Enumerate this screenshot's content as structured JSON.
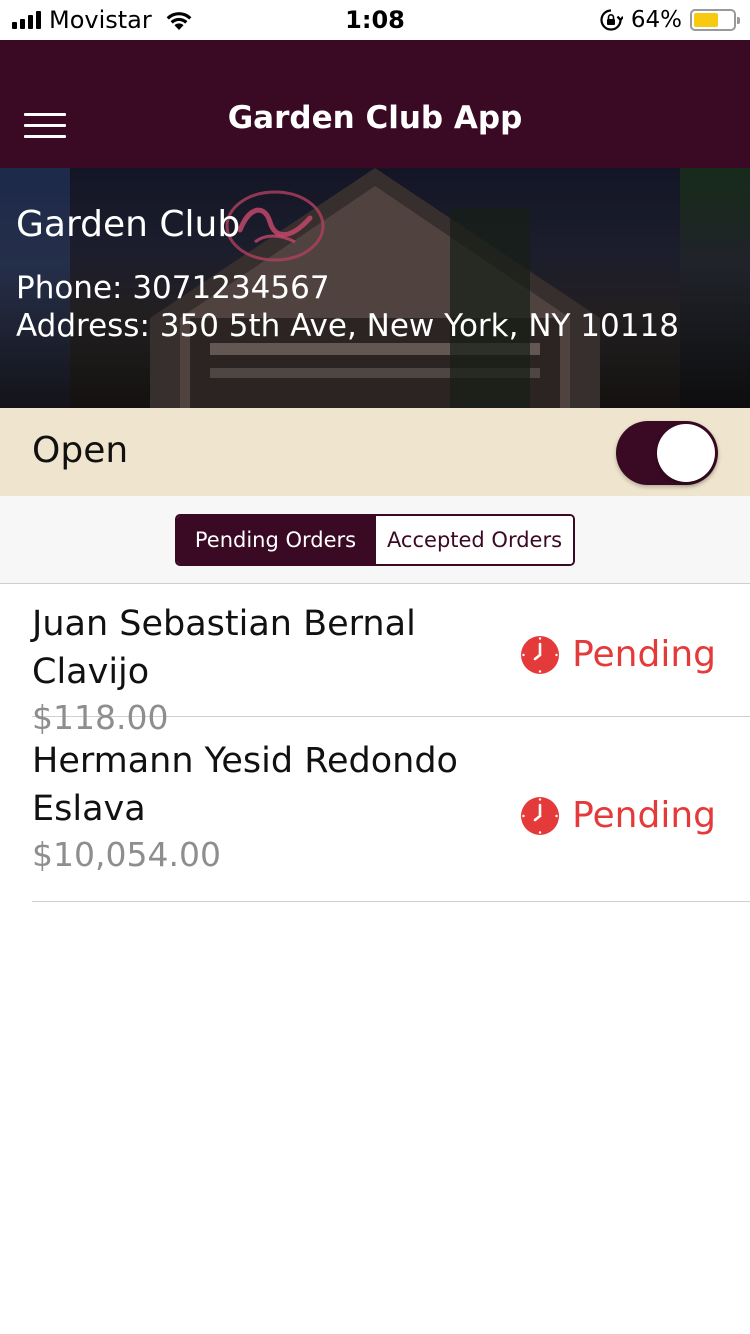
{
  "status_bar": {
    "carrier": "Movistar",
    "time": "1:08",
    "battery_percent": "64%",
    "battery_level": 0.64,
    "icons": [
      "signal-icon",
      "wifi-icon",
      "rotation-lock-icon",
      "battery-icon"
    ]
  },
  "nav": {
    "title": "Garden Club App",
    "menu_icon": "hamburger-menu-icon"
  },
  "restaurant": {
    "name": "Garden Club",
    "phone": "Phone: 3071234567",
    "address": "Address: 350 5th Ave, New York, NY 10118"
  },
  "open_status": {
    "label": "Open",
    "toggle_on": true
  },
  "tabs": [
    {
      "label": "Pending Orders",
      "active": true
    },
    {
      "label": "Accepted Orders",
      "active": false
    }
  ],
  "orders": [
    {
      "customer": "Juan Sebastian Bernal Clavijo",
      "total": "$118.00",
      "status": "Pending"
    },
    {
      "customer": "Hermann Yesid Redondo Eslava",
      "total": "$10,054.00",
      "status": "Pending"
    }
  ],
  "colors": {
    "primary": "#3a0a24",
    "open_bar": "#efe4cd",
    "pending": "#e53a3a",
    "total_text": "#8e8e8e"
  }
}
